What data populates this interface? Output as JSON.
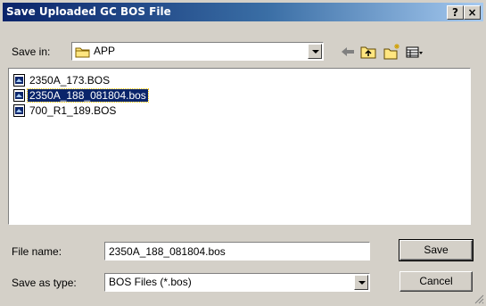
{
  "window": {
    "title": "Save Uploaded GC BOS File",
    "help_label": "?",
    "close_label": "×"
  },
  "location": {
    "label": "Save in:",
    "value": "APP",
    "folder_icon": "folder-icon"
  },
  "toolbar": [
    "back-arrow-icon",
    "up-folder-icon",
    "new-folder-icon",
    "view-menu-icon"
  ],
  "files": [
    {
      "name": "2350A_173.BOS",
      "selected": false
    },
    {
      "name": "2350A_188_081804.bos",
      "selected": true
    },
    {
      "name": "700_R1_189.BOS",
      "selected": false
    }
  ],
  "filename": {
    "label": "File name:",
    "value": "2350A_188_081804.bos"
  },
  "filetype": {
    "label": "Save as type:",
    "value": "BOS Files (*.bos)"
  },
  "buttons": {
    "save": "Save",
    "cancel": "Cancel"
  },
  "colors": {
    "titlebar_start": "#0a246a",
    "titlebar_end": "#a6caf0",
    "selection": "#0a246a",
    "face": "#d4d0c8"
  }
}
